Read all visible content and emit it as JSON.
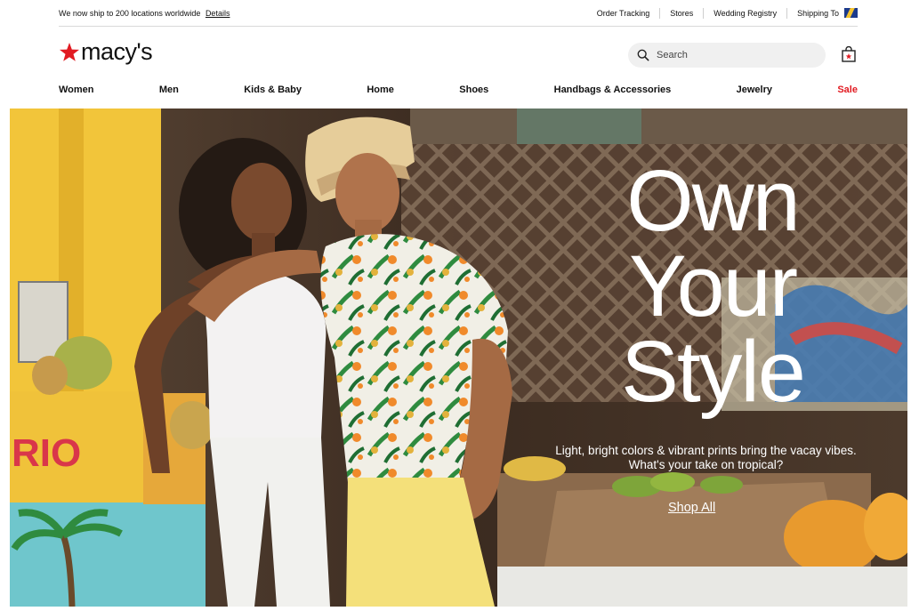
{
  "utility_bar": {
    "promo_text": "We now ship to 200 locations worldwide",
    "promo_link": "Details",
    "links": [
      "Order Tracking",
      "Stores",
      "Wedding Registry",
      "Shipping To"
    ]
  },
  "header": {
    "logo_text": "macy's",
    "search_placeholder": "Search",
    "brand_color": "#e11b22"
  },
  "nav": {
    "items": [
      "Women",
      "Men",
      "Kids & Baby",
      "Home",
      "Shoes",
      "Handbags & Accessories",
      "Jewelry",
      "Sale"
    ]
  },
  "hero": {
    "headline_lines": [
      "Own",
      "Your",
      "Style"
    ],
    "subline_1": "Light, bright colors & vibrant prints bring the vacay vibes.",
    "subline_2": "What's your take on tropical?",
    "cta": "Shop All",
    "wall_text": "RIO"
  }
}
